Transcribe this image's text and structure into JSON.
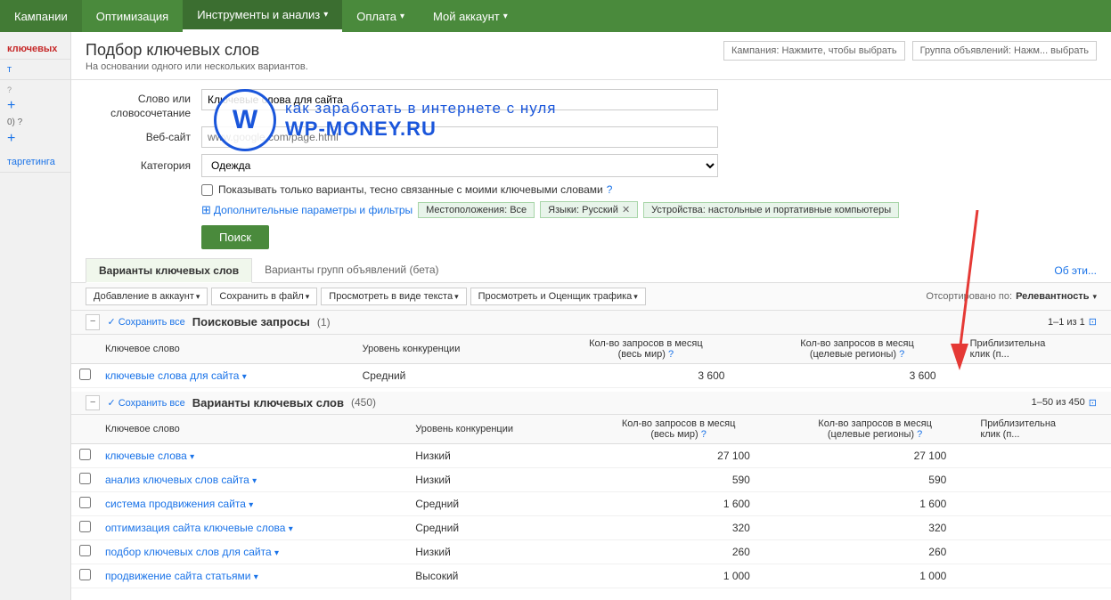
{
  "nav": {
    "items": [
      {
        "label": "Кампании",
        "active": false
      },
      {
        "label": "Оптимизация",
        "active": false
      },
      {
        "label": "Инструменты и анализ",
        "active": true,
        "hasArrow": true
      },
      {
        "label": "Оплата",
        "active": false,
        "hasArrow": true
      },
      {
        "label": "Мой аккаунт",
        "active": false,
        "hasArrow": true
      }
    ]
  },
  "sidebar": {
    "items": [
      {
        "label": "ключевых",
        "active": true
      },
      {
        "label": "т",
        "active": false
      },
      {
        "label": "таргетинга",
        "active": false
      }
    ]
  },
  "page": {
    "title": "Подбор ключевых слов",
    "subtitle": "На основании одного или нескольких вариантов.",
    "campaign_label": "Кампания: Нажмите, чтобы выбрать",
    "adgroup_label": "Группа объявлений: Нажм... выбрать"
  },
  "form": {
    "word_label": "Слово или\nсловосочетание",
    "word_value": "Ключевые слова для сайта",
    "website_label": "Веб-сайт",
    "website_placeholder": "www.google.com/page.html",
    "category_label": "Категория",
    "category_value": "Одежда",
    "checkbox_label": "Показывать только варианты, тесно связанные с моими ключевыми словами",
    "filter_toggle": "Дополнительные параметры и фильтры",
    "location_tag": "Местоположения: Все",
    "language_tag": "Языки: Русский",
    "devices_tag": "Устройства: настольные и портативные компьютеры",
    "search_button": "Поиск"
  },
  "watermark": {
    "logo_text": "W",
    "text1": "как заработать в интернете с нуля",
    "text2": "WP-MONEY.RU"
  },
  "tabs": {
    "items": [
      {
        "label": "Варианты ключевых слов",
        "active": true
      },
      {
        "label": "Варианты групп объявлений (бета)",
        "active": false
      }
    ],
    "about_link": "Об эти..."
  },
  "toolbar": {
    "add_button": "Добавление в аккаунт",
    "save_button": "Сохранить в файл",
    "view_text_button": "Просмотреть в виде текста",
    "view_traffic_button": "Просмотреть и Оценщик трафика",
    "sort_label": "Отсортировано по:",
    "sort_value": "Релевантность"
  },
  "search_queries": {
    "section_title": "Поисковые запросы",
    "section_count": "(1)",
    "save_all": "✓ Сохранить все",
    "pagination": "1–1 из 1",
    "columns": [
      {
        "label": "Ключевое слово"
      },
      {
        "label": "Уровень конкуренции"
      },
      {
        "label": "Кол-во запросов в месяц\n(весь мир)"
      },
      {
        "label": "Кол-во запросов в месяц\n(целевые регионы)"
      },
      {
        "label": "Приблизительна\nклик (п..."
      }
    ],
    "rows": [
      {
        "keyword": "ключевые слова для сайта",
        "competition": "Средний",
        "global_monthly": "3 600",
        "local_monthly": "3 600",
        "cpc": ""
      }
    ]
  },
  "keyword_variants": {
    "section_title": "Варианты ключевых слов",
    "section_count": "(450)",
    "save_all": "✓ Сохранить все",
    "pagination": "1–50 из 450",
    "columns": [
      {
        "label": "Ключевое слово"
      },
      {
        "label": "Уровень конкуренции"
      },
      {
        "label": "Кол-во запросов в месяц\n(весь мир)"
      },
      {
        "label": "Кол-во запросов в месяц\n(целевые регионы)"
      },
      {
        "label": "Приблизительна\nклик (п..."
      }
    ],
    "rows": [
      {
        "keyword": "ключевые слова",
        "competition": "Низкий",
        "global_monthly": "27 100",
        "local_monthly": "27 100",
        "cpc": ""
      },
      {
        "keyword": "анализ ключевых слов сайта",
        "competition": "Низкий",
        "global_monthly": "590",
        "local_monthly": "590",
        "cpc": ""
      },
      {
        "keyword": "система продвижения сайта",
        "competition": "Средний",
        "global_monthly": "1 600",
        "local_monthly": "1 600",
        "cpc": ""
      },
      {
        "keyword": "оптимизация сайта ключевые слова",
        "competition": "Средний",
        "global_monthly": "320",
        "local_monthly": "320",
        "cpc": ""
      },
      {
        "keyword": "подбор ключевых слов для сайта",
        "competition": "Низкий",
        "global_monthly": "260",
        "local_monthly": "260",
        "cpc": ""
      },
      {
        "keyword": "продвижение сайта статьями",
        "competition": "Высокий",
        "global_monthly": "1 000",
        "local_monthly": "1 000",
        "cpc": ""
      }
    ]
  }
}
